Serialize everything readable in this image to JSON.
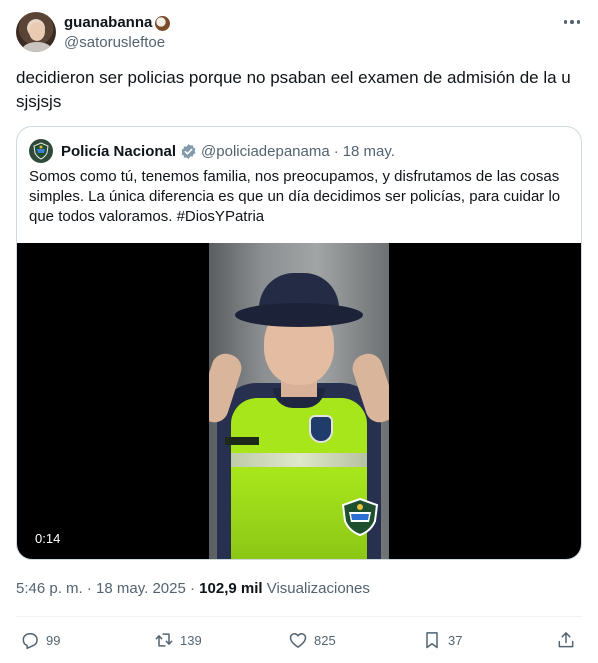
{
  "tweet": {
    "author": {
      "name": "guanabanna",
      "handle": "@satorusleftoe",
      "name_emoji": "coconut-icon"
    },
    "text": "decidieron ser policias porque no psaban eel examen de admisión de la u sjsjsjs",
    "quote": {
      "author": {
        "name": "Policía Nacional",
        "handle": "@policiadepanama",
        "verified": true
      },
      "separator": "·",
      "date": "18 may.",
      "text": "Somos como tú, tenemos familia, nos preocupamos, y disfrutamos de las cosas simples. La única diferencia es que un día decidimos ser policías, para cuidar lo que todos valoramos. #DiosYPatria",
      "video": {
        "duration": "0:14"
      }
    },
    "meta": {
      "time": "5:46 p. m.",
      "separator": "·",
      "date": "18 may. 2025",
      "views_count": "102,9 mil",
      "views_label": "Visualizaciones"
    },
    "actions": {
      "replies": "99",
      "reposts": "139",
      "likes": "825",
      "bookmarks": "37"
    }
  },
  "colors": {
    "text_primary": "#0f1419",
    "text_secondary": "#536471",
    "border": "#cfd9de",
    "verified_badge": "#829aab"
  }
}
